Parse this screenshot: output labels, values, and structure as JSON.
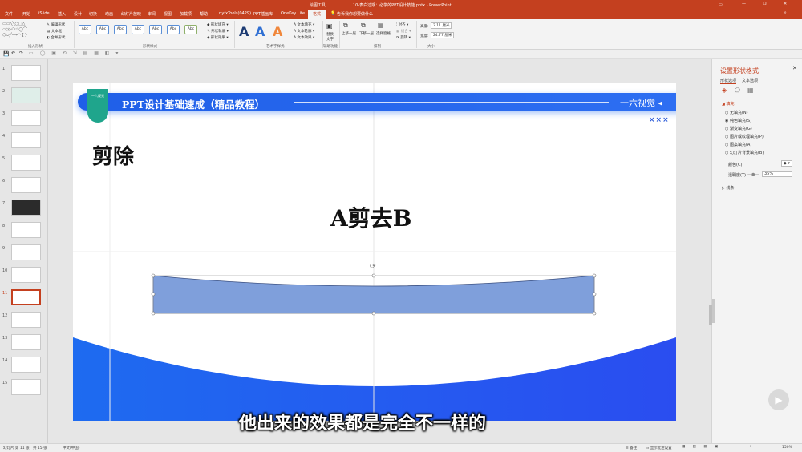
{
  "titlebar": {
    "context": "绘图工具",
    "doc": "10-表白过期：必学的PPT设计技能.pptx  -  PowerPoint",
    "login": "登录"
  },
  "tabs": [
    "文件",
    "开始",
    "iSlide",
    "插入",
    "设计",
    "切换",
    "动画",
    "幻灯片放映",
    "审阅",
    "视图",
    "加载项",
    "帮助",
    "i rlyfxTools(0429)",
    "PPT插画库",
    "OneKey Lite",
    "格式"
  ],
  "tell_me": "告诉我你想要做什么",
  "ribbon": {
    "insert_shapes": "插入形状",
    "shape_styles": "形状样式",
    "wordart": "艺术字样式",
    "accessibility": "辅助功能",
    "arrange": "排列",
    "size": "大小",
    "edit_shape": "编辑形状",
    "textbox": "文本框",
    "merge_shapes": "合并形状",
    "style_swatch": "Abc",
    "shape_fill": "形状填充",
    "shape_outline": "形状轮廓",
    "shape_effects": "形状效果",
    "text_fill": "文本填充",
    "text_outline": "文本轮廓",
    "text_effects": "文本效果",
    "alt_text": "替换文字",
    "bring_forward": "上移一层",
    "send_backward": "下移一层",
    "selection_pane": "选择窗格",
    "align": "对齐",
    "group": "组合",
    "rotate": "旋转",
    "height_label": "高度:",
    "height": "2.11 厘米",
    "width_label": "宽度:",
    "width": "24.77 厘米"
  },
  "slides": [
    "1",
    "2",
    "3",
    "4",
    "5",
    "6",
    "7",
    "8",
    "9",
    "10",
    "11",
    "12",
    "13",
    "14",
    "15"
  ],
  "slide": {
    "banner_title": "PPT设计基础速成（精品教程）",
    "banner_right": "一六视觉",
    "logo_text": "一六视觉",
    "xxx": "×××",
    "heading": "剪除",
    "subheading": "A剪去B"
  },
  "pane": {
    "title": "设置形状格式",
    "tab1": "形状选项",
    "tab2": "文本选项",
    "fill": "填充",
    "options": [
      "无填充(N)",
      "纯色填充(S)",
      "渐变填充(G)",
      "图片或纹理填充(P)",
      "图案填充(A)",
      "幻灯片背景填充(B)"
    ],
    "selected": 1,
    "color_label": "颜色(C)",
    "transparency_label": "透明度(T)",
    "transparency": "35%",
    "line": "线条"
  },
  "status": {
    "slide": "幻灯片 第 11 张，共 15 张",
    "lang": "中文(中国)",
    "notes": "备注",
    "comments": "显示批注设置",
    "zoom": "150%"
  },
  "caption": "他出来的效果都是完全不一样的",
  "colors": {
    "accent": "#c4401f",
    "banner": "#2266ee",
    "shape": "#7f9fdb"
  }
}
